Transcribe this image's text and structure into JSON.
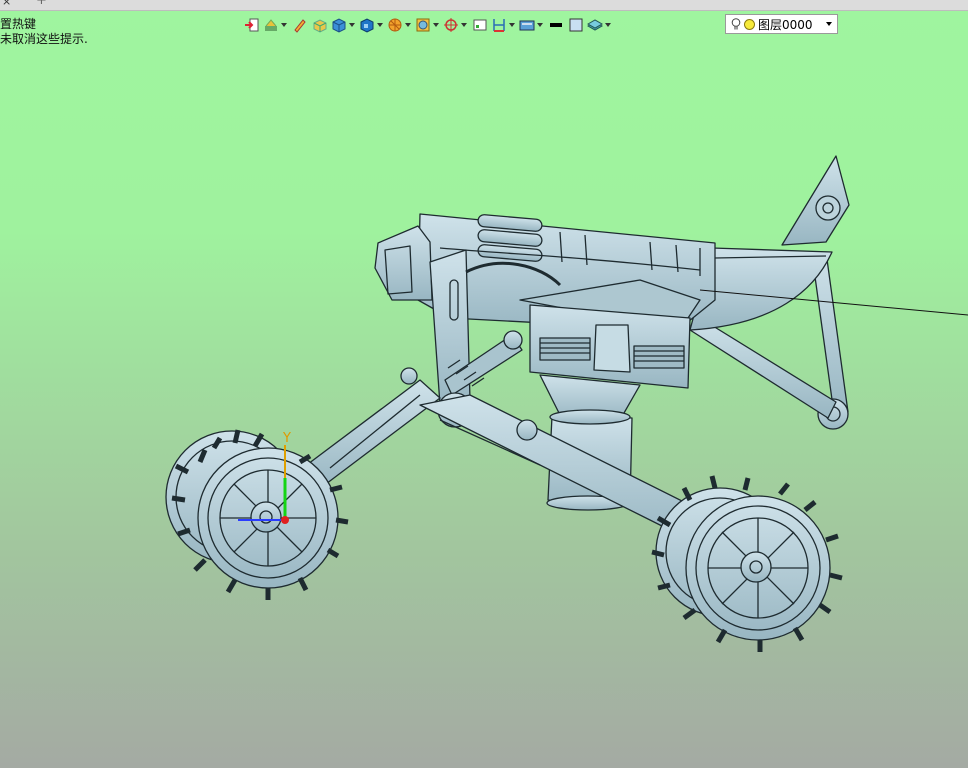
{
  "tabs": {
    "close_glyph": "×",
    "add_glyph": "+"
  },
  "hint": {
    "line1": "置热键",
    "line2": "未取消这些提示."
  },
  "toolbar": {
    "items": [
      {
        "icon": "import-arrow-icon",
        "dropdown": false
      },
      {
        "icon": "sketch-tools-icon",
        "dropdown": true
      },
      {
        "icon": "pencil-icon",
        "dropdown": false
      },
      {
        "icon": "extrude-box-icon",
        "dropdown": false
      },
      {
        "icon": "solid-box-icon",
        "dropdown": true
      },
      {
        "icon": "shell-box-icon",
        "dropdown": true
      },
      {
        "icon": "pattern-icon",
        "dropdown": true
      },
      {
        "icon": "transform-icon",
        "dropdown": true
      },
      {
        "icon": "datum-point-icon",
        "dropdown": true
      },
      {
        "icon": "view-frame-icon",
        "dropdown": false
      },
      {
        "icon": "dimension-icon",
        "dropdown": true
      },
      {
        "icon": "render-mode-icon",
        "dropdown": true
      },
      {
        "icon": "line-color-icon",
        "dropdown": false
      },
      {
        "icon": "fill-color-icon",
        "dropdown": false
      },
      {
        "icon": "layer-manager-icon",
        "dropdown": true
      }
    ]
  },
  "layer": {
    "current": "图层0000"
  },
  "axes": {
    "y_label": "Y"
  },
  "colors": {
    "model_fill": "#b7cfd8",
    "model_edge": "#1e2b30",
    "background_top": "#9ff59f",
    "background_bottom": "#a4aaa3"
  }
}
